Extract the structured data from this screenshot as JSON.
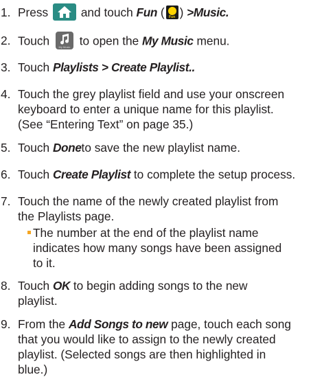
{
  "steps": [
    {
      "num": "1.",
      "parts": {
        "a": "Press",
        "b": "and touch",
        "c": "Fun",
        "d": "(",
        "e": ")",
        "f": ">Music.",
        "fun_icon_label": "Fun"
      }
    },
    {
      "num": "2.",
      "parts": {
        "a": "Touch",
        "b": "to open the",
        "c": "My Music",
        "d": "menu.",
        "music_icon_label": "My Music"
      }
    },
    {
      "num": "3.",
      "parts": {
        "a": "Touch",
        "b": "Playlists > Create Playlist.."
      }
    },
    {
      "num": "4.",
      "lines": [
        "Touch the grey playlist field and use your onscreen",
        "keyboard to enter a unique name for this playlist.",
        "(See “Entering Text” on page 35.)"
      ]
    },
    {
      "num": "5.",
      "parts": {
        "a": "Touch",
        "b": "Done",
        "c": "to save the new playlist name."
      }
    },
    {
      "num": "6.",
      "parts": {
        "a": "Touch",
        "b": "Create Playlist",
        "c": "to complete the setup process."
      }
    },
    {
      "num": "7.",
      "lines": [
        "Touch the name of the newly created playlist from",
        "the Playlists page."
      ]
    },
    {
      "bullet_lines": [
        "The number at the end of the playlist name",
        "indicates how many songs have been assigned",
        "to it."
      ]
    },
    {
      "num": "8.",
      "parts": {
        "a": "Touch",
        "b": "OK",
        "c": "to begin adding songs to the new"
      },
      "lines": [
        "",
        "playlist."
      ]
    },
    {
      "num": "9.",
      "parts": {
        "a": "From the",
        "b": "Add Songs to new",
        "c": "page, touch each song"
      },
      "lines": [
        "",
        "that you would like to assign to the newly created",
        "playlist. (Selected songs are then highlighted in",
        "blue.)"
      ]
    }
  ]
}
